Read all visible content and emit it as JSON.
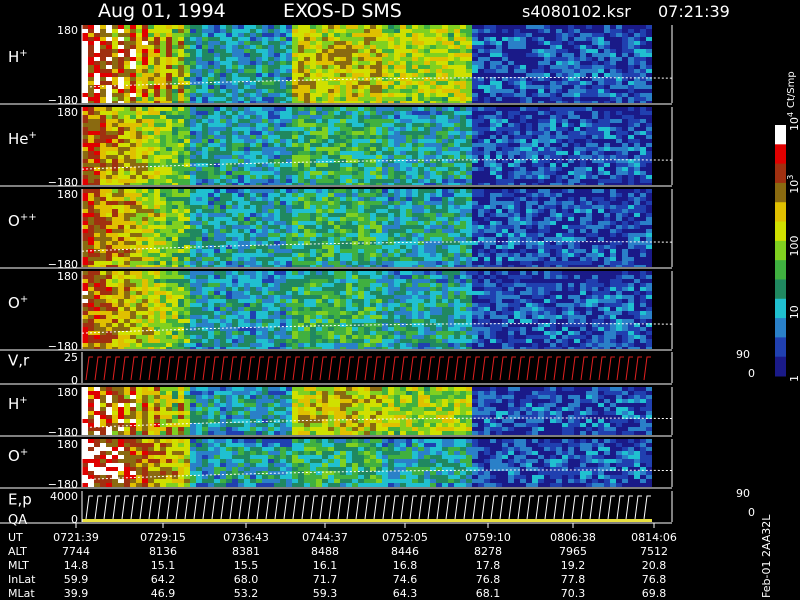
{
  "header": {
    "date": "Aug 01, 1994",
    "instrument": "EXOS-D SMS",
    "file": "s4080102.ksr",
    "time": "07:21:39"
  },
  "colors": {
    "background": "#000000",
    "low_count": "#1a2a9a",
    "scale": [
      "#1a1a88",
      "#2040b0",
      "#2a80c8",
      "#20c0d0",
      "#208860",
      "#40b040",
      "#80d020",
      "#d0e000",
      "#e0c000",
      "#8a6a10",
      "#a03010",
      "#e00000",
      "#ffffff"
    ]
  },
  "chart_data": {
    "type": "heatmap",
    "panels": [
      {
        "id": "h",
        "label": "H",
        "superscript": "+",
        "y_ticks": [
          "180",
          "−180"
        ]
      },
      {
        "id": "he",
        "label": "He",
        "superscript": "+",
        "y_ticks": [
          "180",
          "−180"
        ]
      },
      {
        "id": "opp",
        "label": "O",
        "superscript": "++",
        "y_ticks": [
          "180",
          "−180"
        ]
      },
      {
        "id": "op",
        "label": "O",
        "superscript": "+",
        "y_ticks": [
          "180",
          "−180"
        ]
      },
      {
        "id": "vr",
        "label": "V,r",
        "superscript": "",
        "y_ticks": [
          "25",
          "0"
        ],
        "right_ticks": [
          "90",
          "0"
        ]
      },
      {
        "id": "h2",
        "label": "H",
        "superscript": "+",
        "y_ticks": [
          "180",
          "−180"
        ]
      },
      {
        "id": "o2",
        "label": "O",
        "superscript": "+",
        "y_ticks": [
          "180",
          "−180"
        ]
      },
      {
        "id": "ep",
        "label": "E,p",
        "label2": "QA",
        "superscript": "",
        "y_ticks": [
          "4000",
          "0"
        ],
        "right_ticks": [
          "90",
          "0"
        ]
      }
    ],
    "colorbar": {
      "label": "Ct/Smp",
      "ticks": [
        {
          "base": "10",
          "exp": "4",
          "value": 10000
        },
        {
          "base": "10",
          "exp": "3",
          "value": 1000
        },
        {
          "base": "100",
          "exp": "",
          "value": 100
        },
        {
          "base": "10",
          "exp": "",
          "value": 10
        },
        {
          "base": "1",
          "exp": "",
          "value": 1
        }
      ],
      "scale": "log"
    },
    "x_axis": {
      "rows": [
        {
          "label": "UT",
          "values": [
            "0721:39",
            "0729:15",
            "0736:43",
            "0744:37",
            "0752:05",
            "0759:10",
            "0806:38",
            "0814:06"
          ]
        },
        {
          "label": "ALT",
          "values": [
            "7744",
            "8136",
            "8381",
            "8488",
            "8446",
            "8278",
            "7965",
            "7512"
          ]
        },
        {
          "label": "MLT",
          "values": [
            "14.8",
            "15.1",
            "15.5",
            "16.1",
            "16.8",
            "17.8",
            "19.2",
            "20.8"
          ]
        },
        {
          "label": "InLat",
          "values": [
            "59.9",
            "64.2",
            "68.0",
            "71.7",
            "74.6",
            "76.8",
            "77.8",
            "76.8"
          ]
        },
        {
          "label": "MLat",
          "values": [
            "39.9",
            "46.9",
            "53.2",
            "59.3",
            "64.3",
            "68.1",
            "70.3",
            "69.8"
          ]
        }
      ]
    },
    "footer_id": "Feb-01 2AA32L"
  }
}
